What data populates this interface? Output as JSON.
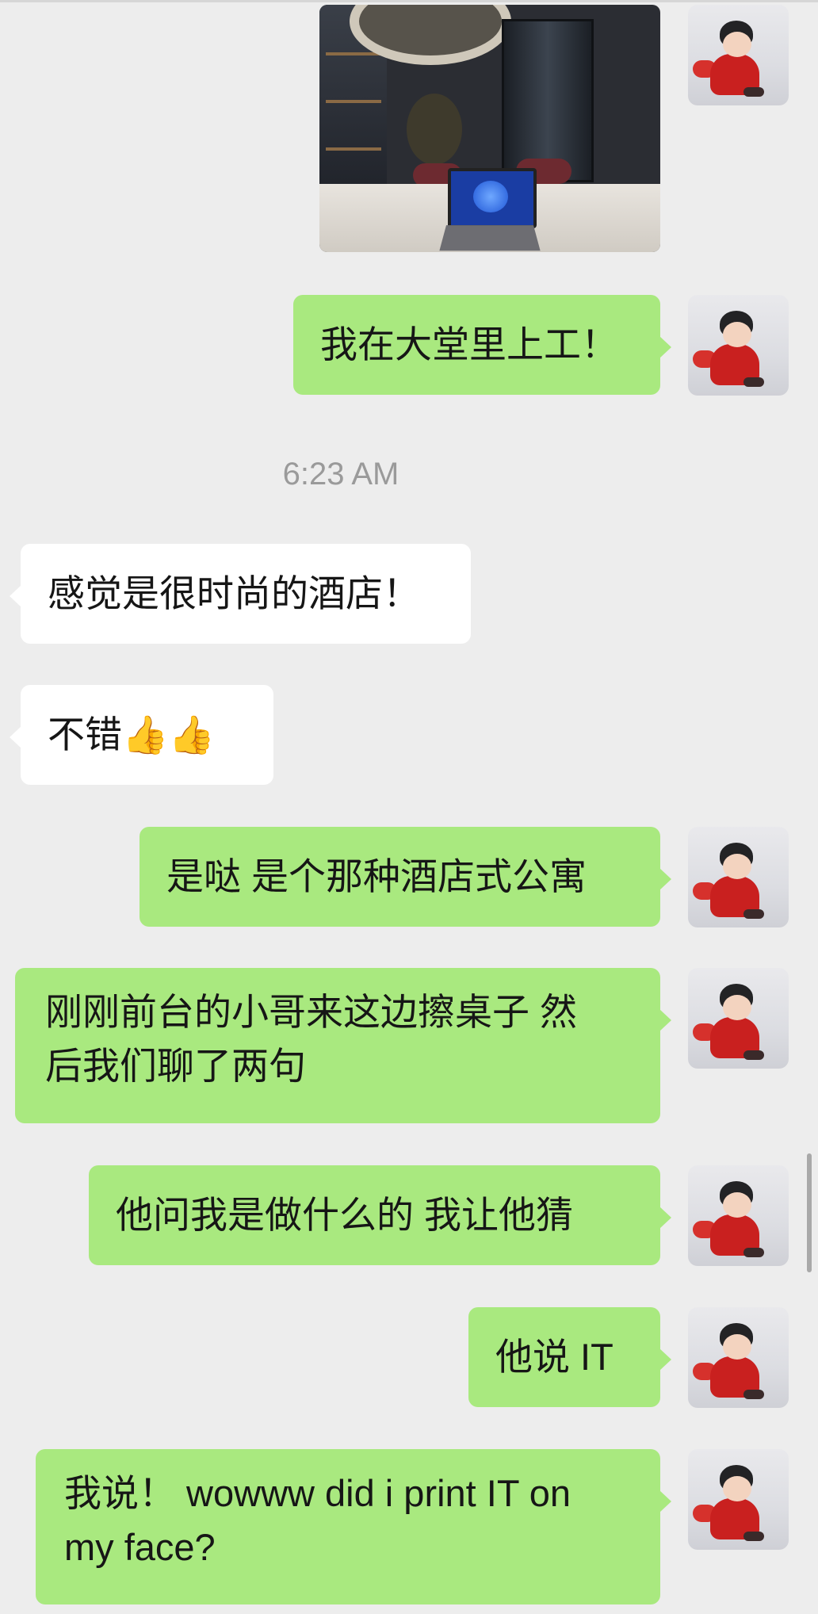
{
  "conversation": {
    "timestamp": "6:23 AM",
    "messages": [
      {
        "id": "m1",
        "from": "me",
        "type": "image"
      },
      {
        "id": "m2",
        "from": "me",
        "text": "我在大堂里上工！"
      },
      {
        "id": "m3",
        "from": "them",
        "text": "感觉是很时尚的酒店！"
      },
      {
        "id": "m4",
        "from": "them",
        "text": "不错",
        "emoji": "👍👍"
      },
      {
        "id": "m5",
        "from": "me",
        "text": "是哒 是个那种酒店式公寓"
      },
      {
        "id": "m6",
        "from": "me",
        "lines": [
          "刚刚前台的小哥来这边擦桌子 然",
          "后我们聊了两句"
        ]
      },
      {
        "id": "m7",
        "from": "me",
        "text": "他问我是做什么的 我让他猜"
      },
      {
        "id": "m8",
        "from": "me",
        "text": "他说 IT"
      },
      {
        "id": "m9",
        "from": "me",
        "lines": [
          "我说！ wowww did i print IT on",
          "my face?"
        ]
      }
    ]
  },
  "colors": {
    "background": "#ededed",
    "outgoing_bubble": "#a9e97f",
    "incoming_bubble": "#ffffff",
    "timestamp": "#9a9a9a"
  }
}
